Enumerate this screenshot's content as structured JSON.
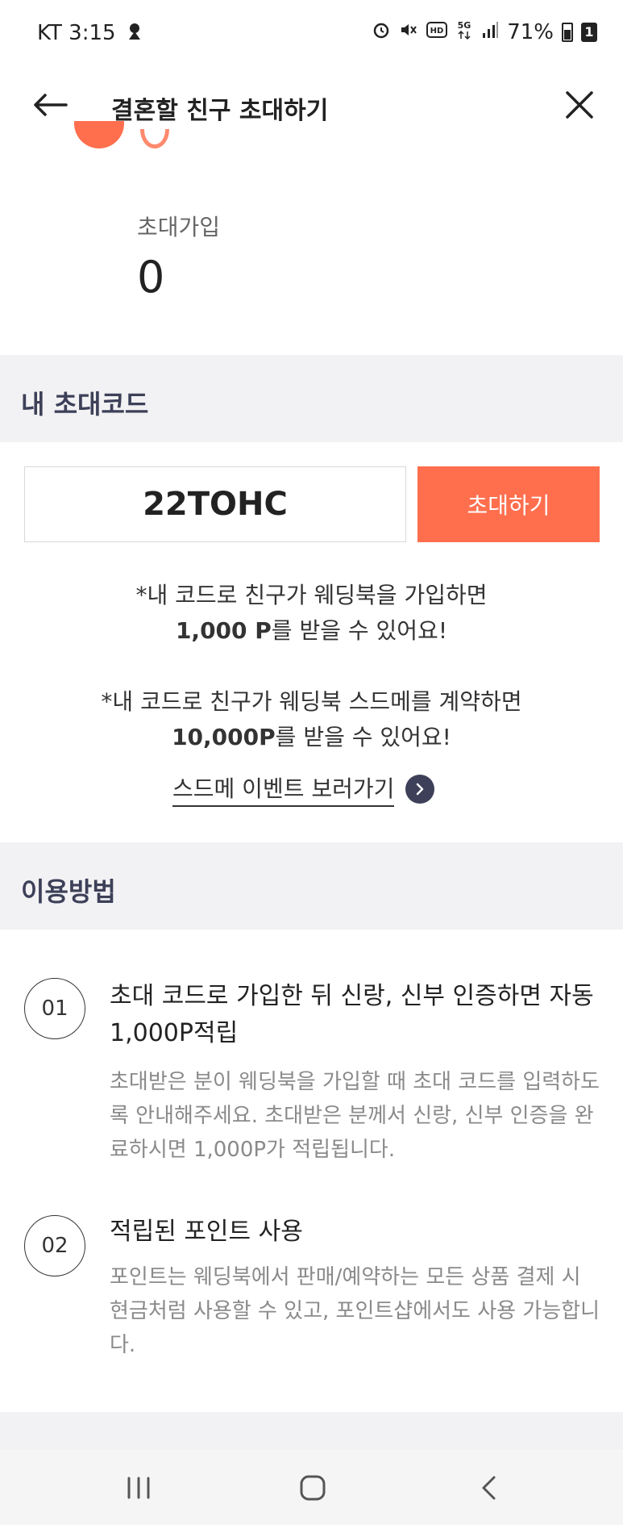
{
  "status_bar": {
    "carrier_time": "KT 3:15",
    "battery_percent": "71%",
    "sim_slot": "1"
  },
  "header": {
    "title": "결혼할 친구 초대하기"
  },
  "stats": {
    "label": "초대가입",
    "value": "0"
  },
  "my_code_section": {
    "title": "내 초대코드",
    "code": "22TOHC",
    "invite_button": "초대하기"
  },
  "info": {
    "signup_line1": "*내 코드로 친구가 웨딩북을 가입하면",
    "signup_bold": "1,000 P",
    "signup_line2_rest": "를 받을 수 있어요!",
    "contract_line1": "*내 코드로 친구가 웨딩북 스드메를 계약하면",
    "contract_bold": "10,000P",
    "contract_line2_rest": "를 받을 수 있어요!",
    "event_link": "스드메 이벤트 보러가기"
  },
  "howto": {
    "title": "이용방법",
    "steps": [
      {
        "number": "01",
        "title": "초대 코드로 가입한 뒤 신랑, 신부 인증하면 자동 1,000P적립",
        "desc": "초대받은 분이 웨딩북을 가입할 때 초대 코드를 입력하도록 안내해주세요. 초대받은 분께서 신랑, 신부 인증을 완료하시면 1,000P가 적립됩니다."
      },
      {
        "number": "02",
        "title": "적립된 포인트 사용",
        "desc": "포인트는 웨딩북에서 판매/예약하는 모든 상품 결제 시 현금처럼 사용할 수 있고, 포인트샵에서도 사용 가능합니다."
      }
    ]
  },
  "colors": {
    "accent": "#ff6f4e",
    "section_bg": "#f2f2f4",
    "section_title": "#3d4058"
  }
}
